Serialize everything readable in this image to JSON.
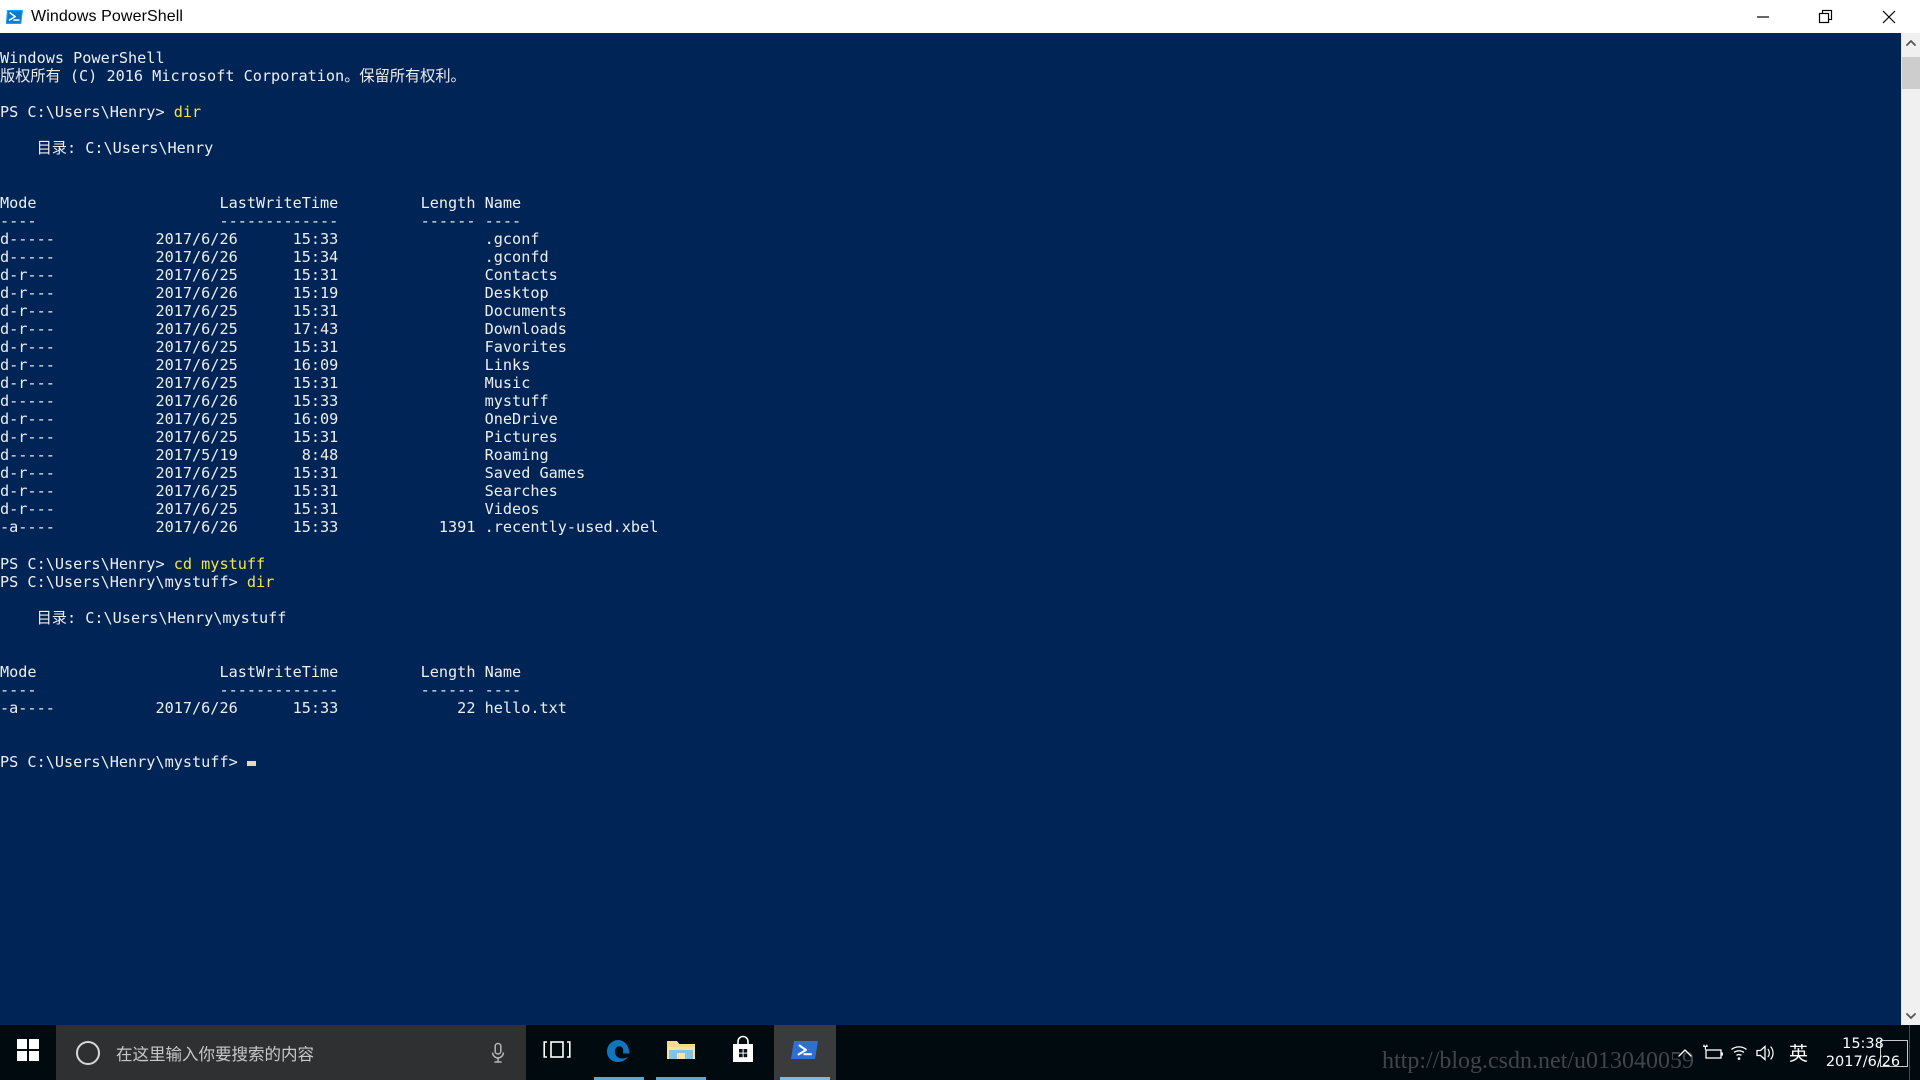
{
  "window": {
    "title": "Windows PowerShell",
    "icon": "powershell-icon",
    "minimize_label": "—",
    "restore_label": "❐",
    "close_label": "✕",
    "background_color": "#012456",
    "foreground_color": "#eeeeee",
    "command_color": "#f3e73c"
  },
  "console": {
    "banner": [
      "Windows PowerShell",
      "版权所有 (C) 2016 Microsoft Corporation。保留所有权利。"
    ],
    "blocks": [
      {
        "prompt": "PS C:\\Users\\Henry>",
        "command": "dir",
        "directory_label": "    目录: C:\\Users\\Henry",
        "headers": {
          "mode": "Mode",
          "lastwritetime": "LastWriteTime",
          "length": "Length",
          "name": "Name"
        },
        "header_rules": {
          "mode": "----",
          "lastwritetime": "-------------",
          "length": "------",
          "name": "----"
        },
        "rows": [
          {
            "mode": "d-----",
            "date": "2017/6/26",
            "time": "15:33",
            "length": "",
            "name": ".gconf"
          },
          {
            "mode": "d-----",
            "date": "2017/6/26",
            "time": "15:34",
            "length": "",
            "name": ".gconfd"
          },
          {
            "mode": "d-r---",
            "date": "2017/6/25",
            "time": "15:31",
            "length": "",
            "name": "Contacts"
          },
          {
            "mode": "d-r---",
            "date": "2017/6/26",
            "time": "15:19",
            "length": "",
            "name": "Desktop"
          },
          {
            "mode": "d-r---",
            "date": "2017/6/25",
            "time": "15:31",
            "length": "",
            "name": "Documents"
          },
          {
            "mode": "d-r---",
            "date": "2017/6/25",
            "time": "17:43",
            "length": "",
            "name": "Downloads"
          },
          {
            "mode": "d-r---",
            "date": "2017/6/25",
            "time": "15:31",
            "length": "",
            "name": "Favorites"
          },
          {
            "mode": "d-r---",
            "date": "2017/6/25",
            "time": "16:09",
            "length": "",
            "name": "Links"
          },
          {
            "mode": "d-r---",
            "date": "2017/6/25",
            "time": "15:31",
            "length": "",
            "name": "Music"
          },
          {
            "mode": "d-----",
            "date": "2017/6/26",
            "time": "15:33",
            "length": "",
            "name": "mystuff"
          },
          {
            "mode": "d-r---",
            "date": "2017/6/25",
            "time": "16:09",
            "length": "",
            "name": "OneDrive"
          },
          {
            "mode": "d-r---",
            "date": "2017/6/25",
            "time": "15:31",
            "length": "",
            "name": "Pictures"
          },
          {
            "mode": "d-----",
            "date": "2017/5/19",
            "time": "8:48",
            "length": "",
            "name": "Roaming"
          },
          {
            "mode": "d-r---",
            "date": "2017/6/25",
            "time": "15:31",
            "length": "",
            "name": "Saved Games"
          },
          {
            "mode": "d-r---",
            "date": "2017/6/25",
            "time": "15:31",
            "length": "",
            "name": "Searches"
          },
          {
            "mode": "d-r---",
            "date": "2017/6/25",
            "time": "15:31",
            "length": "",
            "name": "Videos"
          },
          {
            "mode": "-a----",
            "date": "2017/6/26",
            "time": "15:33",
            "length": "1391",
            "name": ".recently-used.xbel"
          }
        ]
      },
      {
        "prompt": "PS C:\\Users\\Henry>",
        "command": "cd mystuff"
      },
      {
        "prompt": "PS C:\\Users\\Henry\\mystuff>",
        "command": "dir",
        "directory_label": "    目录: C:\\Users\\Henry\\mystuff",
        "headers": {
          "mode": "Mode",
          "lastwritetime": "LastWriteTime",
          "length": "Length",
          "name": "Name"
        },
        "header_rules": {
          "mode": "----",
          "lastwritetime": "-------------",
          "length": "------",
          "name": "----"
        },
        "rows": [
          {
            "mode": "-a----",
            "date": "2017/6/26",
            "time": "15:33",
            "length": "22",
            "name": "hello.txt"
          }
        ]
      }
    ],
    "final_prompt": "PS C:\\Users\\Henry\\mystuff>",
    "cursor": "block-cursor"
  },
  "scrollbar": {
    "up_arrow": "chevron-up-icon",
    "down_arrow": "chevron-down-icon",
    "thumb": "scrollbar-thumb"
  },
  "taskbar": {
    "start": "windows-logo-icon",
    "search": {
      "cortana": "cortana-ring-icon",
      "placeholder": "在这里输入你要搜索的内容",
      "value": "",
      "mic": "microphone-icon"
    },
    "apps": [
      {
        "name": "task-view-icon",
        "label": "Task View",
        "state": "pinned"
      },
      {
        "name": "microsoft-edge-icon",
        "label": "Microsoft Edge",
        "state": "open"
      },
      {
        "name": "file-explorer-icon",
        "label": "File Explorer",
        "state": "open"
      },
      {
        "name": "microsoft-store-icon",
        "label": "Microsoft Store",
        "state": "pinned"
      },
      {
        "name": "powershell-icon",
        "label": "Windows PowerShell",
        "state": "active"
      }
    ],
    "tray": {
      "overflow": "chevron-up-icon",
      "icons": [
        {
          "name": "battery-charging-icon",
          "label": "Battery"
        },
        {
          "name": "wifi-icon",
          "label": "Network"
        },
        {
          "name": "volume-icon",
          "label": "Volume"
        }
      ],
      "ime": "英",
      "clock_time": "15:38",
      "clock_date": "2017/6/26",
      "show_desktop": "show-desktop-button"
    }
  },
  "watermark": {
    "text": "http://blog.csdn.net/u013040059"
  }
}
